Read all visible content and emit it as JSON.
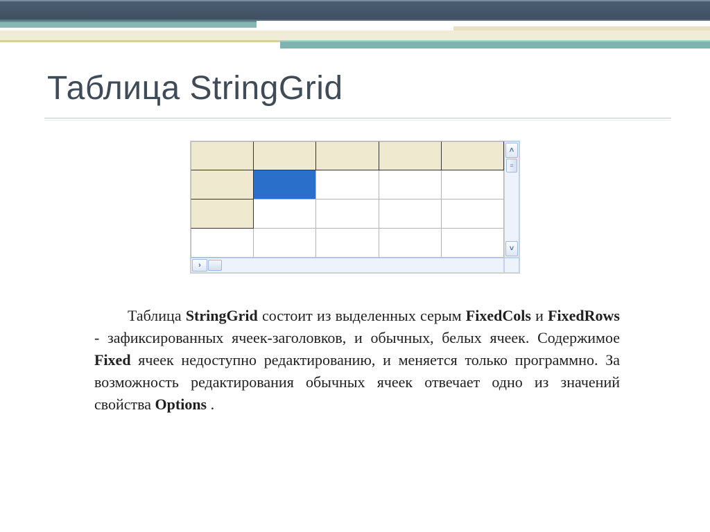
{
  "title": "Таблица StringGrid",
  "grid": {
    "rows": 4,
    "cols": 5,
    "fixed_cols": 1,
    "fixed_rows": 1,
    "fixed_in_col0_rows": 3,
    "focus": {
      "row": 1,
      "col": 1
    }
  },
  "scroll": {
    "up_glyph": "˄",
    "down_glyph": "˅",
    "left_glyph": "‹",
    "right_glyph": "›",
    "thumb_glyph": "≡"
  },
  "text": {
    "t1": "Таблица ",
    "b1": "StringGrid",
    "t2": " состоит из выделенных серым ",
    "b2": "FixedCols",
    "t3": " и ",
    "b3": "FixedRows",
    "t4": " - зафиксированных ячеек-заголовков, и обычных, белых ячеек. Содержимое ",
    "b4": "Fixed",
    "t5": " ячеек недоступно редактированию, и меняется только программно. За возможность редактирования обычных ячеек отвечает одно из значений свойства ",
    "b5": "Options",
    "t6": "."
  }
}
